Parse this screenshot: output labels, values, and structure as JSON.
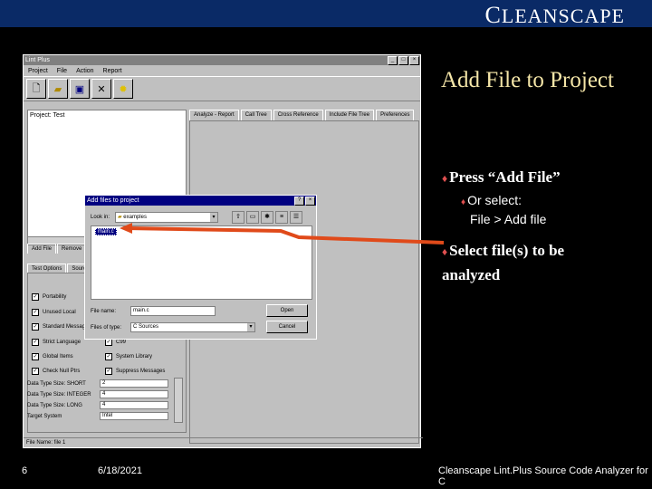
{
  "brand": {
    "initial": "C",
    "rest": "LEANSCAPE"
  },
  "window": {
    "title": "Lint Plus",
    "menu": [
      "Project",
      "File",
      "Action",
      "Report"
    ],
    "toolbar_icons": [
      "new-icon",
      "open-icon",
      "save-icon",
      "analyze-icon",
      "lightbulb-icon"
    ],
    "project_label": "Project: Test",
    "right_tabs": [
      "Analyze - Report",
      "Call Tree",
      "Cross Reference",
      "Include File Tree",
      "Preferences"
    ],
    "sub_tabs": [
      "Add File",
      "Remove"
    ],
    "option_tabs": [
      "Test Options",
      "Source"
    ],
    "checkboxes_left": [
      "Portability",
      "Unused Local",
      "Standard Messages",
      "Strict Language",
      "Global Items",
      "Check Null Ptrs"
    ],
    "checkboxes_right": [
      "C99",
      "System Library",
      "Suppress Messages"
    ],
    "fields": [
      {
        "label": "Data Type Size: SHORT",
        "value": "2"
      },
      {
        "label": "Data Type Size: INTEGER",
        "value": "4"
      },
      {
        "label": "Data Type Size: LONG",
        "value": "4"
      },
      {
        "label": "Target System",
        "value": "Intel"
      }
    ],
    "status": "File Name: file 1"
  },
  "dialog": {
    "title": "Add files to project",
    "look_in_label": "Look in:",
    "look_in_value": "examples",
    "selected_file": "main.c",
    "file_name_label": "File name:",
    "file_name_value": "main.c",
    "file_type_label": "Files of type:",
    "file_type_value": "C Sources",
    "open_button": "Open",
    "cancel_button": "Cancel"
  },
  "slide": {
    "title": "Add File to Project",
    "bullet1": "Press “Add File”",
    "sub1_line1": "Or select:",
    "sub1_line2": "File > Add file",
    "bullet2": "Select file(s) to be analyzed"
  },
  "footer": {
    "page": "6",
    "date": "6/18/2021",
    "product": "Cleanscape Lint.Plus Source Code Analyzer for C"
  },
  "colors": {
    "background": "#000000",
    "topbar": "#0a2a66",
    "title": "#f5e6a8",
    "arrow": "#e04a1a",
    "bullet": "#e05050"
  }
}
